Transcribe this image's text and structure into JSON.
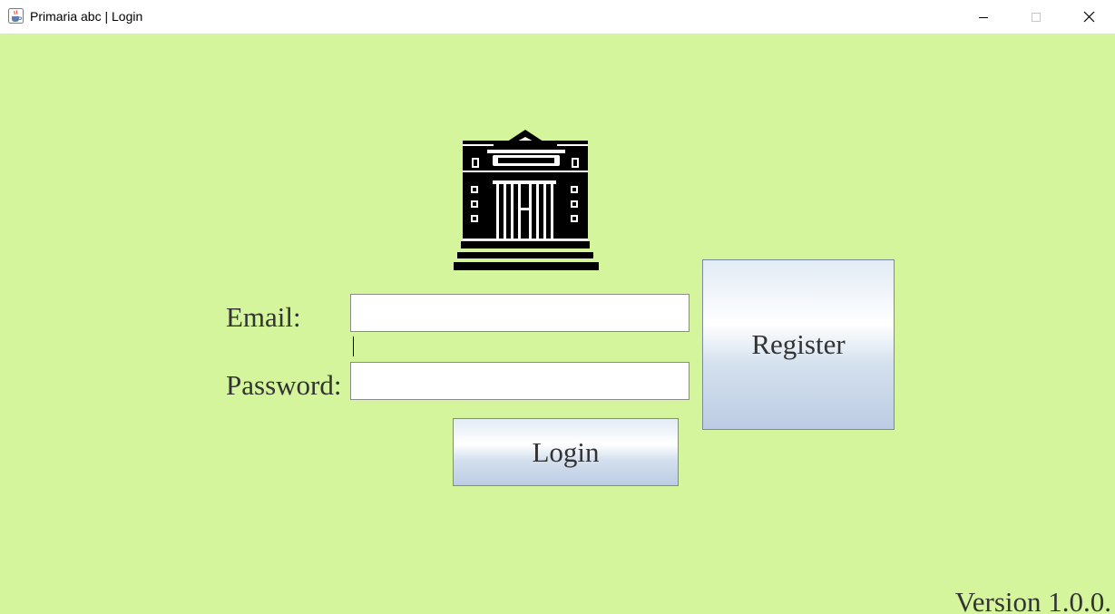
{
  "window": {
    "title": "Primaria abc | Login",
    "app_icon": "java-cup-icon",
    "controls": {
      "minimize": "minimize-icon",
      "maximize": "maximize-icon",
      "close": "close-icon"
    }
  },
  "logo": {
    "icon": "government-building-icon"
  },
  "form": {
    "email_label": "Email:",
    "email_value": "",
    "password_label": "Password:",
    "password_value": "",
    "login_label": "Login",
    "register_label": "Register"
  },
  "footer": {
    "version": "Version 1.0.0."
  },
  "colors": {
    "background": "#d4f59b",
    "text": "#333333",
    "titlebar": "#ffffff"
  }
}
